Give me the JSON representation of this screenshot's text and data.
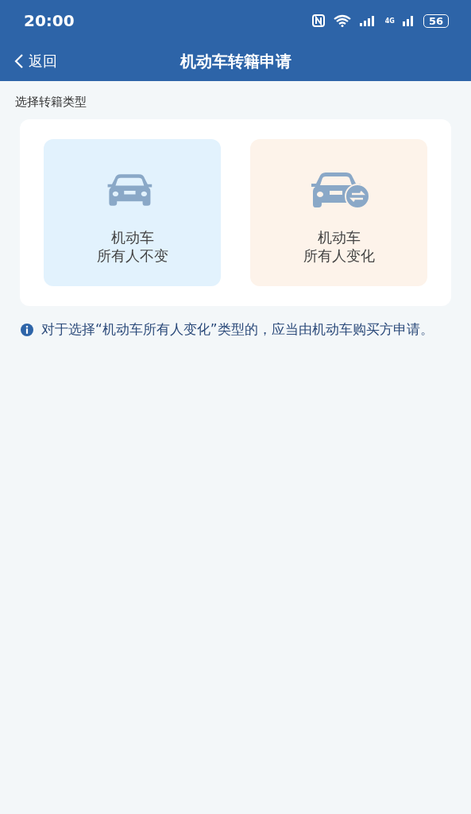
{
  "status_bar": {
    "time": "20:00",
    "network": "4G",
    "battery": "56"
  },
  "nav": {
    "back": "返回",
    "title": "机动车转籍申请"
  },
  "section_label": "选择转籍类型",
  "options": [
    {
      "kind": "keep",
      "line1": "机动车",
      "line2": "所有人不变"
    },
    {
      "kind": "change",
      "line1": "机动车",
      "line2": "所有人变化"
    }
  ],
  "note": "对于选择“机动车所有人变化”类型的，应当由机动车购买方申请。"
}
